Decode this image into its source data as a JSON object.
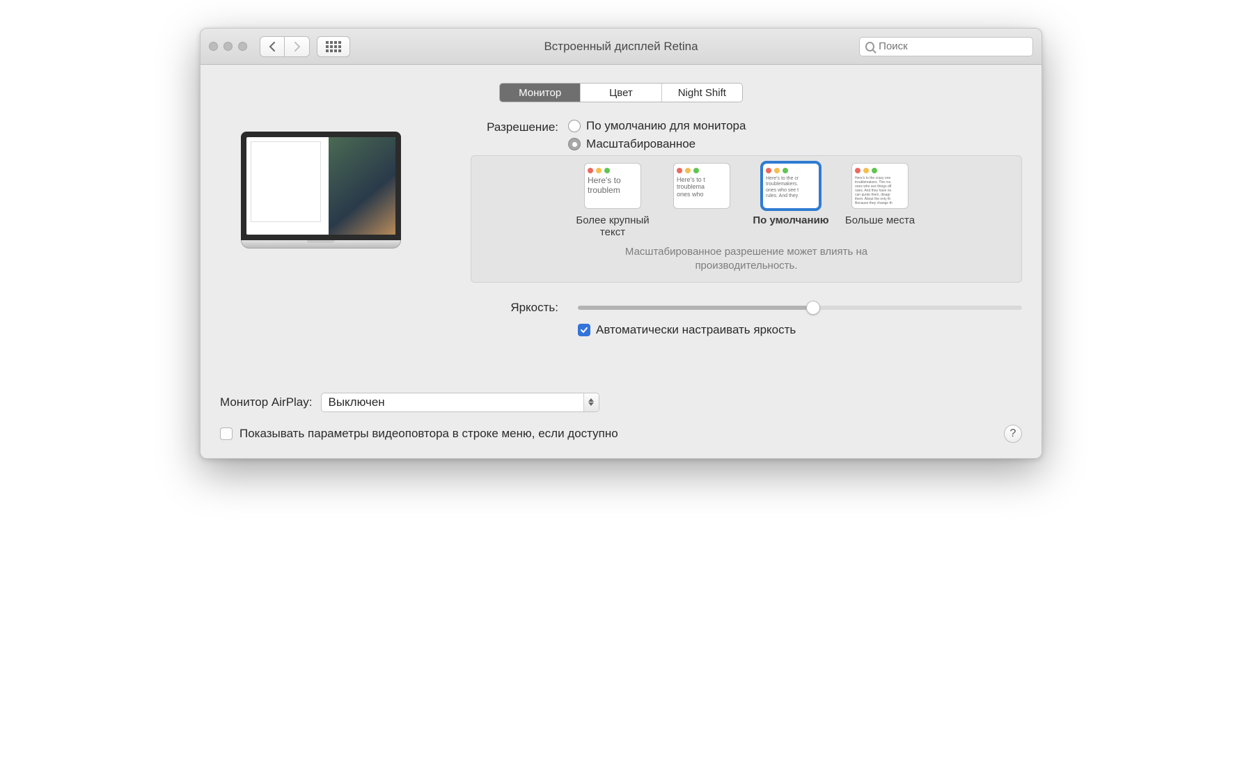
{
  "window": {
    "title": "Встроенный дисплей Retina"
  },
  "search": {
    "placeholder": "Поиск"
  },
  "tabs": {
    "monitor": "Монитор",
    "color": "Цвет",
    "nightshift": "Night Shift"
  },
  "resolution": {
    "label": "Разрешение:",
    "default": "По умолчанию для монитора",
    "scaled": "Масштабированное"
  },
  "scale": {
    "larger": "Более крупный текст",
    "default": "По умолчанию",
    "morespace": "Больше места",
    "note1": "Масштабированное разрешение может влиять на",
    "note2": "производительность."
  },
  "thumbs": {
    "t1": "Here's to\ntroublem",
    "t2": "Here's to t\ntroublema\nones who",
    "t3": "Here's to the cr\ntroublemakers.\nones who see t\nrules. And they",
    "t4": "Here's to the crazy one\ntroublemakers. The rou\nones who see things dif\nrules. And they have no\ncan quote them, disagr\nthem. About the only th\nBecause they change th"
  },
  "brightness": {
    "label": "Яркость:"
  },
  "auto_brightness": "Автоматически настраивать яркость",
  "airplay": {
    "label": "Монитор AirPlay:",
    "value": "Выключен"
  },
  "mirror": "Показывать параметры видеоповтора в строке меню, если доступно",
  "help": "?"
}
